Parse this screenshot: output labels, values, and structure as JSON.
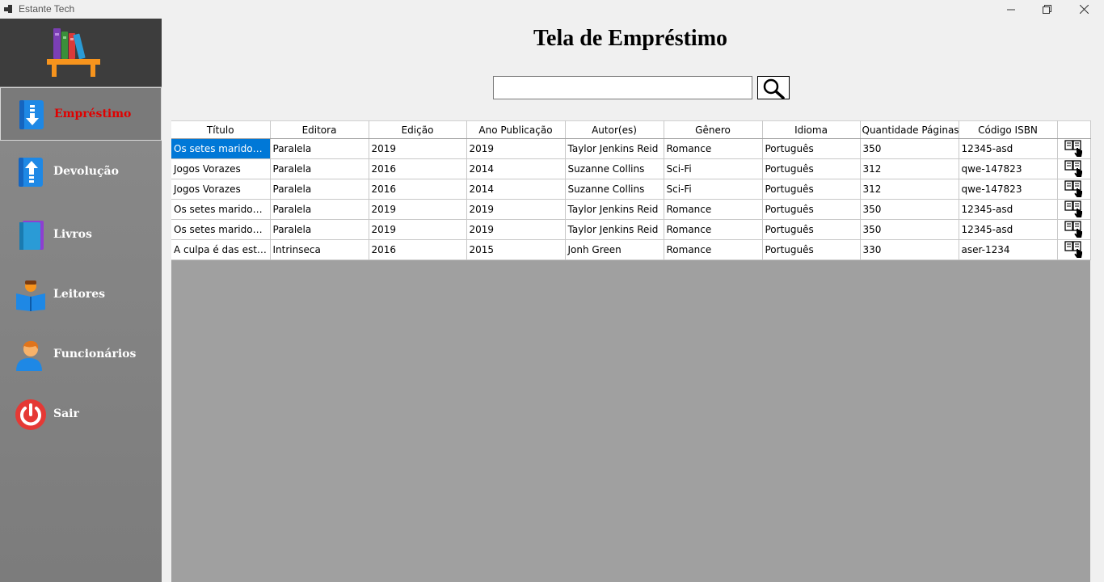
{
  "window": {
    "title": "Estante Tech"
  },
  "sidebar": {
    "items": [
      {
        "label": "Empréstimo",
        "icon": "download-arrow-icon",
        "active": true
      },
      {
        "label": "Devolução",
        "icon": "upload-arrow-icon",
        "active": false
      },
      {
        "label": "Livros",
        "icon": "book-icon",
        "active": false
      },
      {
        "label": "Leitores",
        "icon": "reader-icon",
        "active": false
      },
      {
        "label": "Funcionários",
        "icon": "employee-icon",
        "active": false
      },
      {
        "label": "Sair",
        "icon": "power-icon",
        "active": false
      }
    ]
  },
  "main": {
    "title": "Tela de Empréstimo",
    "search": {
      "value": "",
      "placeholder": ""
    }
  },
  "table": {
    "columns": [
      "Título",
      "Editora",
      "Edição",
      "Ano Publicação",
      "Autor(es)",
      "Gênero",
      "Idioma",
      "Quantidade Páginas",
      "Código ISBN",
      ""
    ],
    "rows": [
      [
        "Os setes maridos de...",
        "Paralela",
        "2019",
        "2019",
        "Taylor  Jenkins Reid",
        "Romance",
        "Português",
        "350",
        "12345-asd"
      ],
      [
        "Jogos Vorazes",
        "Paralela",
        "2016",
        "2014",
        "Suzanne Collins",
        "Sci-Fi",
        "Português",
        "312",
        "qwe-147823"
      ],
      [
        "Jogos Vorazes",
        "Paralela",
        "2016",
        "2014",
        "Suzanne Collins",
        "Sci-Fi",
        "Português",
        "312",
        "qwe-147823"
      ],
      [
        "Os setes maridos de...",
        "Paralela",
        "2019",
        "2019",
        "Taylor  Jenkins Reid",
        "Romance",
        "Português",
        "350",
        "12345-asd"
      ],
      [
        "Os setes maridos de...",
        "Paralela",
        "2019",
        "2019",
        "Taylor  Jenkins Reid",
        "Romance",
        "Português",
        "350",
        "12345-asd"
      ],
      [
        "A culpa é das estrelas",
        "Intrinseca",
        "2016",
        "2015",
        "Jonh Green",
        "Romance",
        "Português",
        "330",
        "aser-1234"
      ]
    ],
    "selected_cell": [
      0,
      0
    ],
    "row_action_icon": "select-book-icon"
  },
  "colors": {
    "active_label": "#e00000",
    "selection": "#0078d7",
    "sidebar": "#858585",
    "grid_background": "#a0a0a0"
  }
}
